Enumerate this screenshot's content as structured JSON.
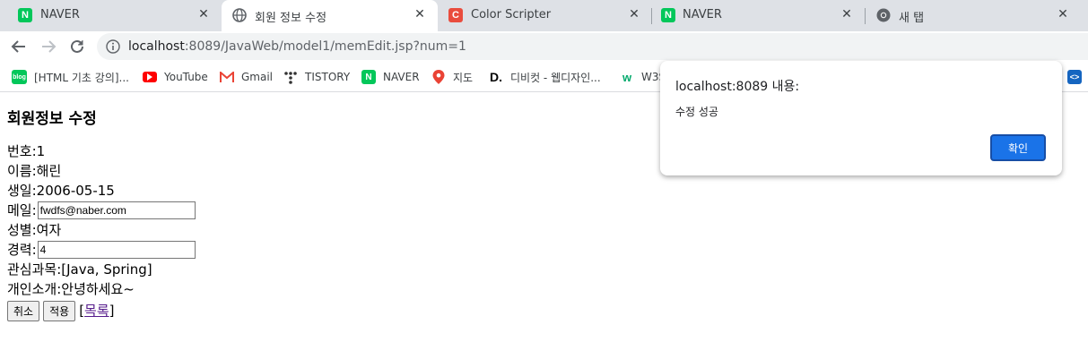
{
  "browser": {
    "tabs": [
      {
        "title": "NAVER",
        "favicon": "naver-icon",
        "active": false
      },
      {
        "title": "회원 정보 수정",
        "favicon": "globe-icon",
        "active": true
      },
      {
        "title": "Color Scripter",
        "favicon": "color-scripter-icon",
        "active": false
      },
      {
        "title": "NAVER",
        "favicon": "naver-icon",
        "active": false
      },
      {
        "title": "새 탭",
        "favicon": "chrome-icon",
        "active": false
      }
    ],
    "close_glyph": "✕",
    "url_host": "localhost",
    "url_path": ":8089/JavaWeb/model1/memEdit.jsp?num=1",
    "bookmarks": [
      {
        "label": "[HTML 기초 강의]...",
        "icon": "blog-icon"
      },
      {
        "label": "YouTube",
        "icon": "youtube-icon"
      },
      {
        "label": "Gmail",
        "icon": "gmail-icon"
      },
      {
        "label": "TISTORY",
        "icon": "tistory-icon"
      },
      {
        "label": "NAVER",
        "icon": "naver-icon"
      },
      {
        "label": "지도",
        "icon": "maps-icon"
      },
      {
        "label": "디비컷 - 웹디자인...",
        "icon": "dbcut-icon"
      },
      {
        "label": "W3S",
        "icon": "w3schools-icon"
      }
    ]
  },
  "page": {
    "heading": "회원정보 수정",
    "num_label": "번호:",
    "num_value": "1",
    "name_label": "이름:",
    "name_value": "해린",
    "birth_label": "생일:",
    "birth_value": "2006-05-15",
    "mail_label": "메일:",
    "mail_value": "fwdfs@naber.com",
    "gender_label": "성별:",
    "gender_value": "여자",
    "career_label": "경력:",
    "career_value": "4",
    "interest_label": "관심과목:",
    "interest_value": "[Java, Spring]",
    "intro_label": "개인소개:",
    "intro_value": "안녕하세요~",
    "cancel_label": "취소",
    "apply_label": "적용",
    "list_open": "[",
    "list_label": "목록",
    "list_close": "]"
  },
  "dialog": {
    "title": "localhost:8089 내용:",
    "message": "수정 성공",
    "ok_label": "확인"
  },
  "colors": {
    "tabstrip": "#dee1e6",
    "naver": "#03c75a",
    "accent": "#1a73e8",
    "link_visited": "#551a8b"
  }
}
